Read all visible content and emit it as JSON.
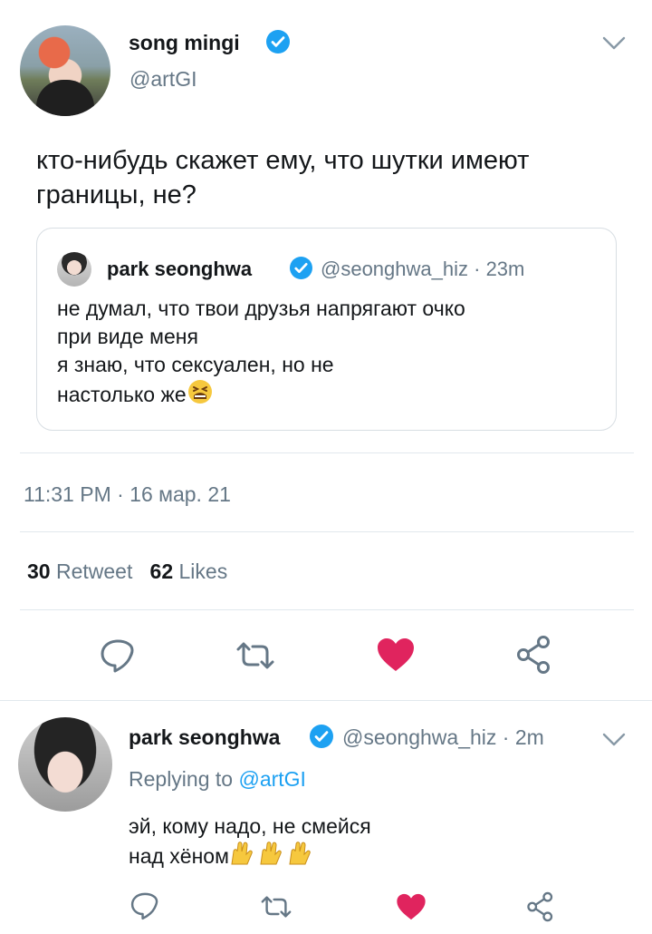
{
  "tweet": {
    "author_name": "song mingi",
    "author_handle": "@artGI",
    "text_line1": "кто-нибудь скажет ему, что шутки имеют",
    "text_line2": "границы, не?",
    "timestamp": "11:31 PM · 16 мар. 21",
    "retweets_count": "30",
    "retweets_label": "Retweet",
    "likes_count": "62",
    "likes_label": "Likes"
  },
  "quoted_tweet": {
    "author_name": "park seonghwa",
    "author_handle": "@seonghwa_hiz",
    "time": "· 23m",
    "text_line1": "не думал, что твои друзья напрягают очко",
    "text_line2": "при виде меня",
    "text_line3": "я знаю, что сексуален, но не",
    "text_line4": "настолько же",
    "emoji": "tired-face-emoji"
  },
  "reply": {
    "author_name": "park seonghwa",
    "author_handle": "@seonghwa_hiz",
    "time": "· 2m",
    "replying_prefix": "Replying to",
    "replying_handle": "@artGI",
    "text_line1": "эй, кому надо, не смейся",
    "text_line2": "над хёном",
    "emoji": "raising-hands-emoji"
  },
  "icons": {
    "verified": "verified-badge-icon",
    "reply": "reply-icon",
    "retweet": "retweet-icon",
    "like": "heart-icon",
    "share": "share-icon",
    "more": "chevron-down-icon"
  },
  "colors": {
    "accent": "#1da1f2",
    "like": "#e0245e",
    "secondary_text": "#657786",
    "primary_text": "#14171a"
  }
}
